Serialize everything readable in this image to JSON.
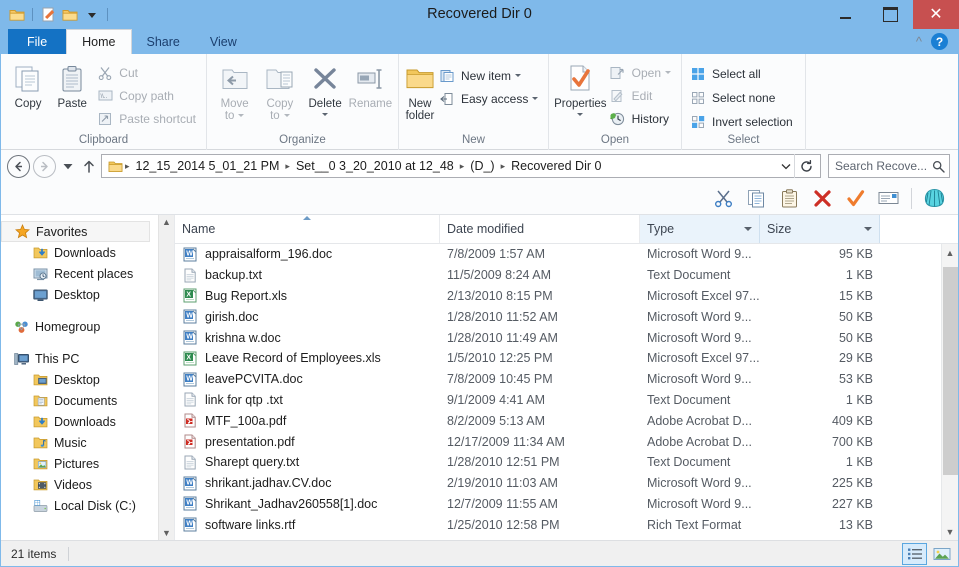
{
  "window": {
    "title": "Recovered Dir 0",
    "quick_access": [
      "folder-icon",
      "new-folder-icon",
      "properties-icon",
      "dropdown-caret"
    ],
    "controls": {
      "minimize": "—",
      "maximize": "❐",
      "close": "✕"
    },
    "close_color": "#c75050",
    "titlebar_color": "#7fb9ea",
    "accent_color": "#1472c4"
  },
  "tabs": [
    {
      "label": "File",
      "state": "file-menu"
    },
    {
      "label": "Home",
      "state": "active"
    },
    {
      "label": "Share",
      "state": "normal"
    },
    {
      "label": "View",
      "state": "normal"
    }
  ],
  "tab_right": {
    "collapse_icon": "chevron-up-icon",
    "help_icon": "help-icon",
    "help_label": "?"
  },
  "ribbon": {
    "groups": [
      {
        "label": "Clipboard",
        "big_buttons": [
          {
            "label": "Copy",
            "icon": "copy-icon",
            "disabled": false
          },
          {
            "label": "Paste",
            "icon": "paste-icon",
            "disabled": false
          }
        ],
        "small_buttons": [
          {
            "label": "Cut",
            "icon": "cut-icon",
            "disabled": true
          },
          {
            "label": "Copy path",
            "icon": "copy-path-icon",
            "disabled": true
          },
          {
            "label": "Paste shortcut",
            "icon": "paste-shortcut-icon",
            "disabled": true
          }
        ]
      },
      {
        "label": "Organize",
        "big_buttons": [
          {
            "label_line1": "Move",
            "label_line2": "to",
            "icon": "move-to-icon",
            "disabled": true,
            "has_caret": true
          },
          {
            "label_line1": "Copy",
            "label_line2": "to",
            "icon": "copy-to-icon",
            "disabled": true,
            "has_caret": true
          },
          {
            "label": "Delete",
            "icon": "delete-icon",
            "disabled": false,
            "has_caret": true
          },
          {
            "label": "Rename",
            "icon": "rename-icon",
            "disabled": true
          }
        ]
      },
      {
        "label": "New",
        "big_buttons": [
          {
            "label_line1": "New",
            "label_line2": "folder",
            "icon": "new-folder-icon",
            "disabled": false
          }
        ],
        "small_buttons": [
          {
            "label": "New item",
            "icon": "new-item-icon",
            "disabled": false,
            "has_caret": true
          },
          {
            "label": "Easy access",
            "icon": "easy-access-icon",
            "disabled": false,
            "has_caret": true
          }
        ]
      },
      {
        "label": "Open",
        "big_buttons": [
          {
            "label": "Properties",
            "icon": "properties-icon",
            "disabled": false,
            "has_caret": true
          }
        ],
        "small_buttons": [
          {
            "label": "Open",
            "icon": "open-icon",
            "disabled": true,
            "has_caret": true
          },
          {
            "label": "Edit",
            "icon": "edit-icon",
            "disabled": true
          },
          {
            "label": "History",
            "icon": "history-icon",
            "disabled": false
          }
        ]
      },
      {
        "label": "Select",
        "small_buttons": [
          {
            "label": "Select all",
            "icon": "select-all-icon",
            "disabled": false
          },
          {
            "label": "Select none",
            "icon": "select-none-icon",
            "disabled": false
          },
          {
            "label": "Invert selection",
            "icon": "invert-selection-icon",
            "disabled": false
          }
        ]
      }
    ]
  },
  "address_bar": {
    "back_icon": "back-arrow-icon",
    "forward_icon": "forward-arrow-icon",
    "recent_icon": "recent-locations-caret",
    "up_icon": "up-arrow-icon",
    "folder_icon": "folder-icon",
    "breadcrumbs": [
      "12_15_2014 5_01_21 PM",
      "Set__0  3_20_2010 at 12_48",
      "(D_)",
      "Recovered Dir 0"
    ],
    "dropdown_icon": "chevron-down-icon",
    "refresh_icon": "refresh-icon",
    "search_placeholder": "Search Recove...",
    "search_value": "",
    "search_icon": "search-icon"
  },
  "toolbar2": {
    "buttons": [
      {
        "name": "cut",
        "icon": "scissors-icon"
      },
      {
        "name": "copy",
        "icon": "copy-pages-icon"
      },
      {
        "name": "paste",
        "icon": "clipboard-icon"
      },
      {
        "name": "delete",
        "icon": "red-x-icon"
      },
      {
        "name": "confirm",
        "icon": "orange-check-icon"
      },
      {
        "name": "rename",
        "icon": "rename-field-icon"
      },
      {
        "name": "shell",
        "icon": "shell-icon"
      }
    ]
  },
  "nav_pane": {
    "items": [
      {
        "label": "Favorites",
        "icon": "star-icon",
        "level": 0,
        "selected": true
      },
      {
        "label": "Downloads",
        "icon": "downloads-folder-icon",
        "level": 1,
        "selected": false
      },
      {
        "label": "Recent places",
        "icon": "recent-places-icon",
        "level": 1,
        "selected": false
      },
      {
        "label": "Desktop",
        "icon": "desktop-icon",
        "level": 1,
        "selected": false
      },
      {
        "gap": true
      },
      {
        "label": "Homegroup",
        "icon": "homegroup-icon",
        "level": 0,
        "selected": false
      },
      {
        "gap": true
      },
      {
        "label": "This PC",
        "icon": "this-pc-icon",
        "level": 0,
        "selected": false
      },
      {
        "label": "Desktop",
        "icon": "desktop-folder-icon",
        "level": 1,
        "selected": false
      },
      {
        "label": "Documents",
        "icon": "documents-folder-icon",
        "level": 1,
        "selected": false
      },
      {
        "label": "Downloads",
        "icon": "downloads-folder-icon",
        "level": 1,
        "selected": false
      },
      {
        "label": "Music",
        "icon": "music-folder-icon",
        "level": 1,
        "selected": false
      },
      {
        "label": "Pictures",
        "icon": "pictures-folder-icon",
        "level": 1,
        "selected": false
      },
      {
        "label": "Videos",
        "icon": "videos-folder-icon",
        "level": 1,
        "selected": false
      },
      {
        "label": "Local Disk (C:)",
        "icon": "local-disk-icon",
        "level": 1,
        "selected": false
      }
    ]
  },
  "file_list": {
    "columns": [
      {
        "label": "Name",
        "sorted": true,
        "sort_dir": "asc",
        "has_caret": false,
        "shaded": false
      },
      {
        "label": "Date modified",
        "sorted": false,
        "has_caret": false,
        "shaded": false
      },
      {
        "label": "Type",
        "sorted": false,
        "has_caret": true,
        "shaded": true
      },
      {
        "label": "Size",
        "sorted": false,
        "has_caret": true,
        "shaded": true
      }
    ],
    "rows": [
      {
        "name": "appraisalform_196.doc",
        "date": "7/8/2009 1:57 AM",
        "type": "Microsoft Word 9...",
        "size": "95 KB",
        "icon": "word-doc-icon"
      },
      {
        "name": "backup.txt",
        "date": "11/5/2009 8:24 AM",
        "type": "Text Document",
        "size": "1 KB",
        "icon": "text-doc-icon"
      },
      {
        "name": "Bug Report.xls",
        "date": "2/13/2010 8:15 PM",
        "type": "Microsoft Excel 97...",
        "size": "15 KB",
        "icon": "excel-doc-icon"
      },
      {
        "name": "girish.doc",
        "date": "1/28/2010 11:52 AM",
        "type": "Microsoft Word 9...",
        "size": "50 KB",
        "icon": "word-doc-icon"
      },
      {
        "name": "krishna w.doc",
        "date": "1/28/2010 11:49 AM",
        "type": "Microsoft Word 9...",
        "size": "50 KB",
        "icon": "word-doc-icon"
      },
      {
        "name": "Leave Record of Employees.xls",
        "date": "1/5/2010 12:25 PM",
        "type": "Microsoft Excel 97...",
        "size": "29 KB",
        "icon": "excel-doc-icon"
      },
      {
        "name": "leavePCVITA.doc",
        "date": "7/8/2009 10:45 PM",
        "type": "Microsoft Word 9...",
        "size": "53 KB",
        "icon": "word-doc-icon"
      },
      {
        "name": "link for qtp .txt",
        "date": "9/1/2009 4:41 AM",
        "type": "Text Document",
        "size": "1 KB",
        "icon": "text-doc-icon"
      },
      {
        "name": "MTF_100a.pdf",
        "date": "8/2/2009 5:13 AM",
        "type": "Adobe Acrobat D...",
        "size": "409 KB",
        "icon": "pdf-doc-icon"
      },
      {
        "name": "presentation.pdf",
        "date": "12/17/2009 11:34 AM",
        "type": "Adobe Acrobat D...",
        "size": "700 KB",
        "icon": "pdf-doc-icon"
      },
      {
        "name": "Sharept query.txt",
        "date": "1/28/2010 12:51 PM",
        "type": "Text Document",
        "size": "1 KB",
        "icon": "text-doc-icon"
      },
      {
        "name": "shrikant.jadhav.CV.doc",
        "date": "2/19/2010 11:03 AM",
        "type": "Microsoft Word 9...",
        "size": "225 KB",
        "icon": "word-doc-icon"
      },
      {
        "name": "Shrikant_Jadhav260558[1].doc",
        "date": "12/7/2009 11:55 AM",
        "type": "Microsoft Word 9...",
        "size": "227 KB",
        "icon": "word-doc-icon"
      },
      {
        "name": "software links.rtf",
        "date": "1/25/2010 12:58 PM",
        "type": "Rich Text Format",
        "size": "13 KB",
        "icon": "word-doc-icon"
      }
    ]
  },
  "status_bar": {
    "item_count": "21 items",
    "view_buttons": [
      {
        "name": "details-view",
        "icon": "details-view-icon",
        "active": true
      },
      {
        "name": "large-icons-view",
        "icon": "large-icons-view-icon",
        "active": false
      }
    ]
  }
}
